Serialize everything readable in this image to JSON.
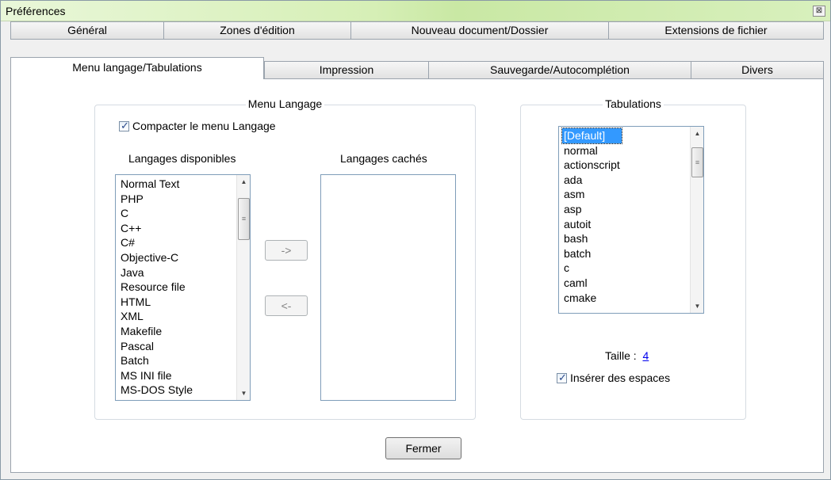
{
  "window": {
    "title": "Préférences",
    "close_glyph": "⊠"
  },
  "tabs": {
    "row1": [
      "Général",
      "Zones d'édition",
      "Nouveau document/Dossier",
      "Extensions de fichier"
    ],
    "row2": [
      "Menu langage/Tabulations",
      "Impression",
      "Sauvegarde/Autocomplétion",
      "Divers"
    ],
    "active": "Menu langage/Tabulations"
  },
  "menu_langage": {
    "group_title": "Menu Langage",
    "compact_label": "Compacter le menu Langage",
    "compact_checked": true,
    "available_label": "Langages disponibles",
    "hidden_label": "Langages cachés",
    "available_items": [
      "Normal Text",
      "PHP",
      "C",
      "C++",
      "C#",
      "Objective-C",
      "Java",
      "Resource file",
      "HTML",
      "XML",
      "Makefile",
      "Pascal",
      "Batch",
      "MS INI file",
      "MS-DOS Style"
    ],
    "hidden_items": [],
    "move_right_label": "->",
    "move_left_label": "<-"
  },
  "tabulations": {
    "group_title": "Tabulations",
    "items": [
      "[Default]",
      "normal",
      "actionscript",
      "ada",
      "asm",
      "asp",
      "autoit",
      "bash",
      "batch",
      "c",
      "caml",
      "cmake"
    ],
    "selected": "[Default]",
    "size_label": "Taille :",
    "size_value": "4",
    "insert_spaces_label": "Insérer des espaces",
    "insert_spaces_checked": true
  },
  "footer": {
    "close_label": "Fermer"
  },
  "icons": {
    "close": "close-icon",
    "up": "scroll-up-icon",
    "down": "scroll-down-icon"
  }
}
